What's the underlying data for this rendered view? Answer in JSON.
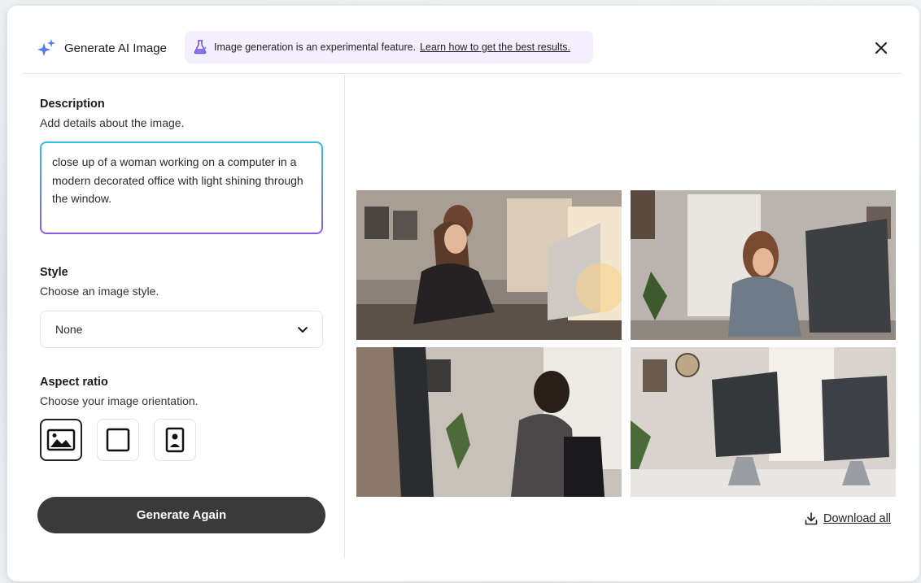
{
  "dialog": {
    "title": "Generate AI Image",
    "banner": {
      "text": "Image generation is an experimental feature.",
      "link": "Learn how to get the best results."
    }
  },
  "form": {
    "description": {
      "title": "Description",
      "subtitle": "Add details about the image.",
      "value": "close up of a woman working on a computer in a modern decorated office with light shining through the window."
    },
    "style": {
      "title": "Style",
      "subtitle": "Choose an image style.",
      "selected": "None"
    },
    "aspect_ratio": {
      "title": "Aspect ratio",
      "subtitle": "Choose your image orientation.",
      "options": [
        "landscape",
        "square",
        "portrait"
      ],
      "selected": "landscape"
    },
    "generate_label": "Generate Again"
  },
  "results": {
    "download_all_label": "Download all",
    "images": [
      "woman in office by window at monitor",
      "woman at large monitor in bright office",
      "woman at computer seen from behind",
      "two monitors on desk in office"
    ]
  },
  "colors": {
    "accent_blue": "#33c0ea",
    "accent_purple": "#8c5ce0",
    "banner_bg": "#f4efff",
    "button_dark": "#3a3a3a"
  }
}
